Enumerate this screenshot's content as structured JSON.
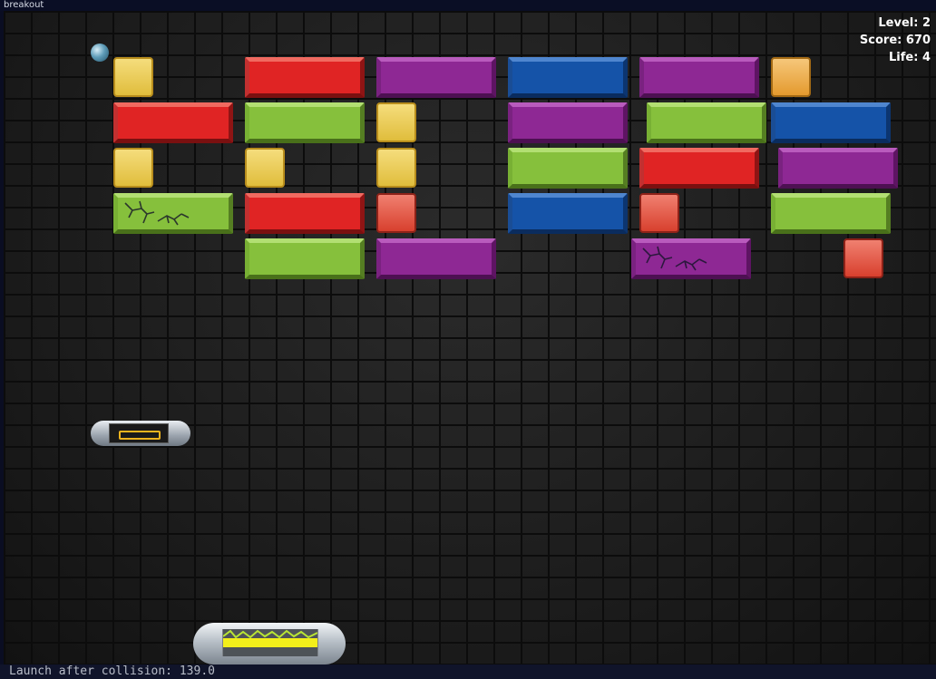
{
  "window": {
    "title": "breakout"
  },
  "hud": {
    "level_text": "Level: 2",
    "score_text": "Score: 670",
    "life_text": "Life: 4"
  },
  "status": {
    "text": "Launch after collision: 139.0"
  },
  "colors": {
    "red": "#e02424",
    "purple": "#8e2894",
    "blue": "#1553a8",
    "green": "#86c03c",
    "yellow": "#f0d060",
    "orange": "#f0b060",
    "red_square": "#e05a48",
    "paddle_fill": "#f3ef1a"
  },
  "paddle": {
    "charge_fraction": 1.0
  },
  "bricks": [
    {
      "row": 1,
      "col": 1,
      "type": "yellow"
    },
    {
      "row": 1,
      "col": 2,
      "type": "red"
    },
    {
      "row": 1,
      "col": 3,
      "type": "purple"
    },
    {
      "row": 1,
      "col": 4,
      "type": "blue"
    },
    {
      "row": 1,
      "col": 5,
      "type": "purple"
    },
    {
      "row": 1,
      "col": 6,
      "type": "orange"
    },
    {
      "row": 2,
      "col": 1,
      "type": "red"
    },
    {
      "row": 2,
      "col": 2,
      "type": "green"
    },
    {
      "row": 2,
      "col": 3,
      "type": "yellow"
    },
    {
      "row": 2,
      "col": 4,
      "type": "purple"
    },
    {
      "row": 2,
      "col": 5,
      "type": "green"
    },
    {
      "row": 2,
      "col": 6,
      "type": "blue"
    },
    {
      "row": 3,
      "col": 1,
      "type": "yellow"
    },
    {
      "row": 3,
      "col": 2,
      "type": "yellow"
    },
    {
      "row": 3,
      "col": 3,
      "type": "yellow"
    },
    {
      "row": 3,
      "col": 4,
      "type": "green"
    },
    {
      "row": 3,
      "col": 5,
      "type": "red"
    },
    {
      "row": 3,
      "col": 6,
      "type": "purple"
    },
    {
      "row": 4,
      "col": 1,
      "type": "green",
      "cracked": true
    },
    {
      "row": 4,
      "col": 2,
      "type": "red"
    },
    {
      "row": 4,
      "col": 3,
      "type": "red-square"
    },
    {
      "row": 4,
      "col": 4,
      "type": "blue"
    },
    {
      "row": 4,
      "col": 5,
      "type": "red-square"
    },
    {
      "row": 4,
      "col": 6,
      "type": "green"
    },
    {
      "row": 5,
      "col": 2,
      "type": "green"
    },
    {
      "row": 5,
      "col": 3,
      "type": "purple"
    },
    {
      "row": 5,
      "col": 5,
      "type": "purple",
      "cracked": true
    },
    {
      "row": 5,
      "col": 6,
      "type": "red-square"
    }
  ]
}
